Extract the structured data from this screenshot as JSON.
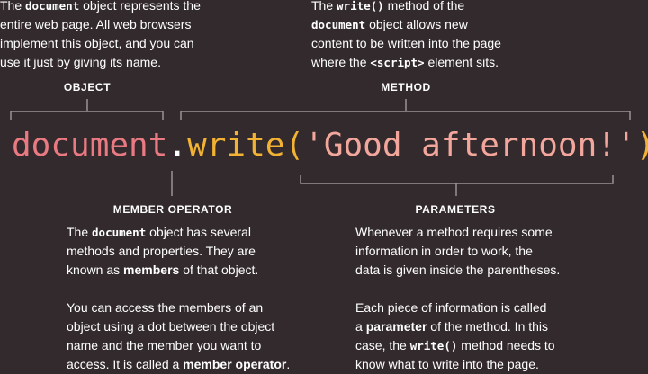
{
  "annotations": {
    "document_desc": {
      "line1": {
        "prefix": "The ",
        "code": "document",
        "suffix": " object represents the"
      },
      "line2": "entire web page. All web browsers",
      "line3": "implement this object, and you can",
      "line4": "use it just by giving its name."
    },
    "write_desc": {
      "line1": {
        "prefix": "The ",
        "code": "write()",
        "suffix": " method of the"
      },
      "line2": {
        "code": "document",
        "suffix": " object allows new"
      },
      "line3": "content to be written into the page",
      "line4": {
        "prefix": "where the ",
        "code": "<script>",
        "suffix": " element sits."
      }
    }
  },
  "labels": {
    "object": "OBJECT",
    "method": "METHOD",
    "member_operator": "MEMBER OPERATOR",
    "parameters": "PARAMETERS"
  },
  "code_line": {
    "object": "document",
    "dot": ".",
    "method": "write",
    "open_paren": "(",
    "parameter": "'Good afternoon!'",
    "close_paren": ")",
    "semicolon": ";"
  },
  "member_desc": {
    "p1_line1": {
      "prefix": "The ",
      "code": "document",
      "suffix": " object has several"
    },
    "p1_line2": "methods and properties. They are",
    "p1_line3": {
      "prefix": "known as ",
      "bold": "members",
      "suffix": " of that object."
    },
    "p2_line1": "You can access the members of an",
    "p2_line2": "object using a dot between the object",
    "p2_line3": "name and the member you want to",
    "p2_line4": {
      "prefix": "access. It is called a ",
      "bold": "member operator",
      "suffix": "."
    }
  },
  "params_desc": {
    "p1_line1": "Whenever a method requires some",
    "p1_line2": "information in order to work, the",
    "p1_line3": "data is given inside the parentheses.",
    "p2_line1": "Each piece of information is called",
    "p2_line2": {
      "prefix": "a ",
      "bold": "parameter",
      "suffix": " of the method. In this"
    },
    "p2_line3": {
      "prefix": "case, the ",
      "code": "write()",
      "suffix": " method needs to"
    },
    "p2_line4": "know what to write into the page."
  },
  "colors": {
    "background": "#332a2d",
    "object": "#ea7a82",
    "method": "#f2b233",
    "parameter": "#f3a79c",
    "bracket_lines": "#9a9396"
  }
}
